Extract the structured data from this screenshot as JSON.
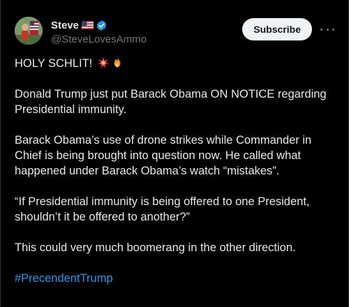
{
  "author": {
    "display_name": "Steve",
    "handle": "@SteveLovesAmmo",
    "flag_icon": "us-flag-icon",
    "verified_icon": "verified-badge-icon",
    "verified_color": "#1d9bf0"
  },
  "actions": {
    "subscribe_label": "Subscribe",
    "more_icon": "more-options-icon"
  },
  "post": {
    "headline": "HOLY SCHLIT!",
    "headline_emojis": [
      "collision-emoji",
      "fire-emoji"
    ],
    "paragraphs": [
      "Donald Trump just put Barack Obama ON NOTICE regarding Presidential immunity.",
      "Barack Obama’s use of drone strikes while Commander in Chief is being brought into question now. He called what happened under Barack Obama’s watch “mistakes”.",
      "“If Presidential immunity is being offered to one President, shouldn’t it be offered to another?”",
      "This could very much boomerang in the other direction."
    ],
    "hashtag": "#PrecendentTrump"
  },
  "colors": {
    "background": "#000000",
    "text": "#e7e9ea",
    "secondary_text": "#71767b",
    "link": "#1d9bf0",
    "button_bg": "#eff3f4"
  }
}
